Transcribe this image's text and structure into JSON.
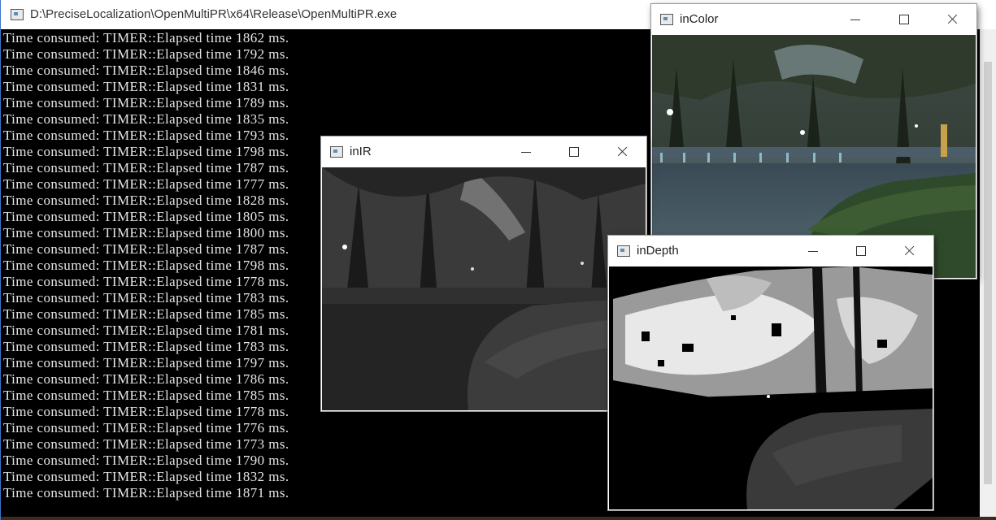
{
  "console": {
    "title": "D:\\PreciseLocalization\\OpenMultiPR\\x64\\Release\\OpenMultiPR.exe",
    "lines": [
      "Time consumed: TIMER::Elapsed time 1862 ms.",
      "Time consumed: TIMER::Elapsed time 1792 ms.",
      "Time consumed: TIMER::Elapsed time 1846 ms.",
      "Time consumed: TIMER::Elapsed time 1831 ms.",
      "Time consumed: TIMER::Elapsed time 1789 ms.",
      "Time consumed: TIMER::Elapsed time 1835 ms.",
      "Time consumed: TIMER::Elapsed time 1793 ms.",
      "Time consumed: TIMER::Elapsed time 1798 ms.",
      "Time consumed: TIMER::Elapsed time 1787 ms.",
      "Time consumed: TIMER::Elapsed time 1777 ms.",
      "Time consumed: TIMER::Elapsed time 1828 ms.",
      "Time consumed: TIMER::Elapsed time 1805 ms.",
      "Time consumed: TIMER::Elapsed time 1800 ms.",
      "Time consumed: TIMER::Elapsed time 1787 ms.",
      "Time consumed: TIMER::Elapsed time 1798 ms.",
      "Time consumed: TIMER::Elapsed time 1778 ms.",
      "Time consumed: TIMER::Elapsed time 1783 ms.",
      "Time consumed: TIMER::Elapsed time 1785 ms.",
      "Time consumed: TIMER::Elapsed time 1781 ms.",
      "Time consumed: TIMER::Elapsed time 1783 ms.",
      "Time consumed: TIMER::Elapsed time 1797 ms.",
      "Time consumed: TIMER::Elapsed time 1786 ms.",
      "Time consumed: TIMER::Elapsed time 1785 ms.",
      "Time consumed: TIMER::Elapsed time 1778 ms.",
      "Time consumed: TIMER::Elapsed time 1776 ms.",
      "Time consumed: TIMER::Elapsed time 1773 ms.",
      "Time consumed: TIMER::Elapsed time 1790 ms.",
      "Time consumed: TIMER::Elapsed time 1832 ms.",
      "Time consumed: TIMER::Elapsed time 1871 ms."
    ]
  },
  "windows": {
    "ir": {
      "title": "inIR"
    },
    "color": {
      "title": "inColor"
    },
    "depth": {
      "title": "inDepth"
    }
  },
  "colors": {
    "console_bg": "#000000",
    "console_text": "#e6e6e6",
    "titlebar_bg": "#ffffff",
    "console_border": "#3a74c7"
  },
  "icons": [
    "app-window-icon",
    "minimize-icon",
    "maximize-icon",
    "close-icon"
  ]
}
